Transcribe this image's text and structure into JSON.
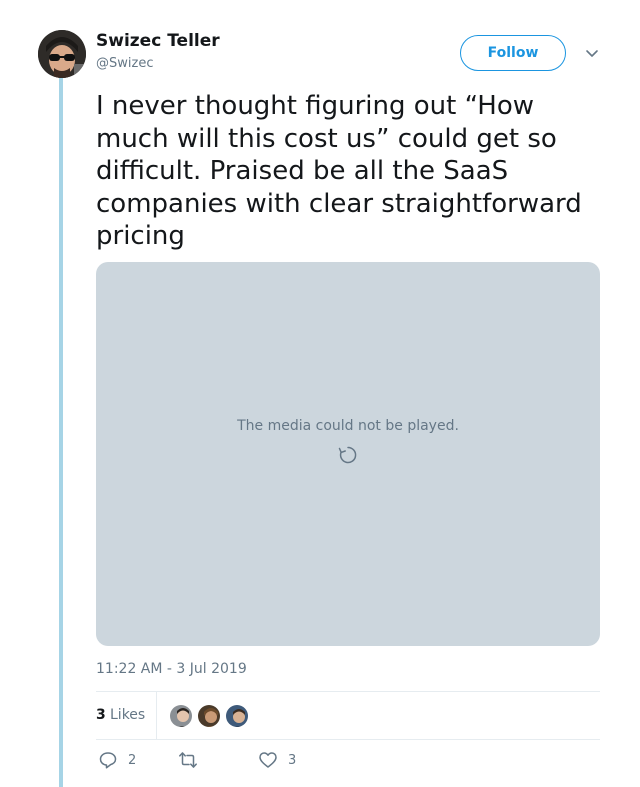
{
  "author": {
    "display_name": "Swizec Teller",
    "handle": "@Swizec"
  },
  "follow_label": "Follow",
  "tweet_text": "I never thought figuring out “How much will this cost us” could get so difficult. Praised be all the SaaS companies with clear straightforward pricing",
  "media": {
    "error_message": "The media could not be played."
  },
  "timestamp": "11:22 AM - 3 Jul 2019",
  "likes": {
    "count": "3",
    "label": "Likes"
  },
  "actions": {
    "replies": "2",
    "retweets": "",
    "likes": "3"
  },
  "colors": {
    "accent": "#1b95e0",
    "thread_line": "#a6d4e6",
    "media_bg": "#ccd6dd",
    "muted_text": "#657786"
  }
}
